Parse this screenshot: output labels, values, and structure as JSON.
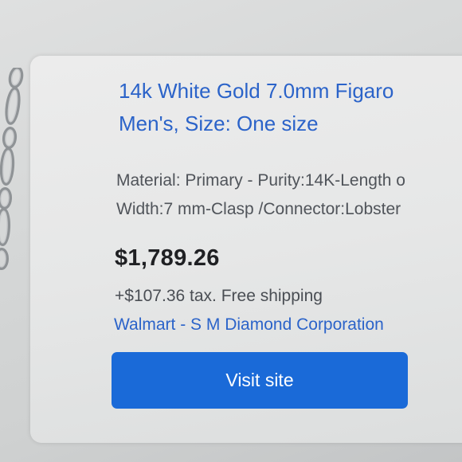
{
  "product": {
    "title_line1": "14k White Gold 7.0mm Figaro",
    "title_line2": "Men's, Size: One size",
    "desc_line1": "Material: Primary - Purity:14K-Length o",
    "desc_line2": "Width:7 mm-Clasp /Connector:Lobster",
    "price": "$1,789.26",
    "tax_shipping": "+$107.36 tax. Free shipping",
    "seller": "Walmart - S M Diamond Corporation",
    "cta_label": "Visit site",
    "thumbnail_icon": "chain-necklace-icon"
  },
  "colors": {
    "link": "#2b63c9",
    "button": "#1a6ad8",
    "price": "#1f2023"
  }
}
